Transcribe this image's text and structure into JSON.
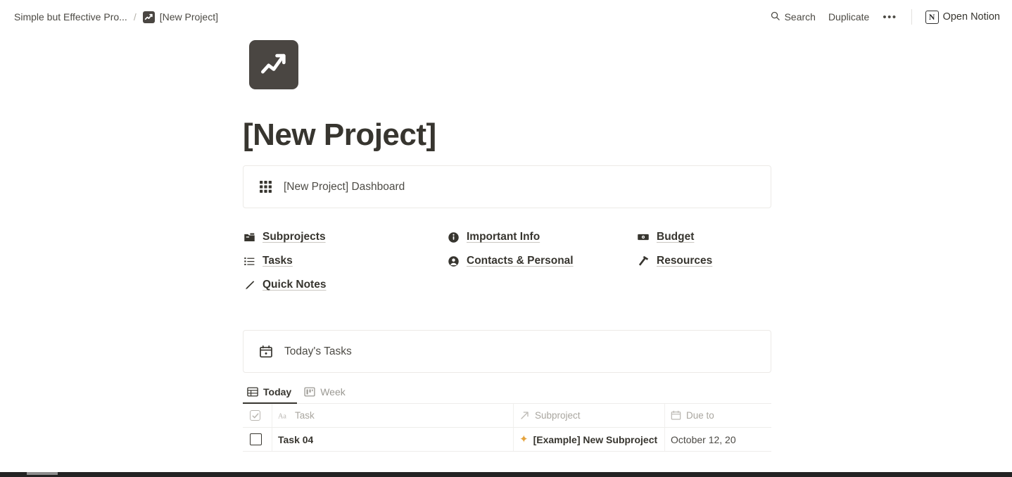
{
  "topbar": {
    "breadcrumb": {
      "parent_label": "Simple but Effective Pro...",
      "separator": "/",
      "current_label": "[New Project]",
      "current_icon": "chart-line-icon"
    },
    "search_label": "Search",
    "search_icon": "search-icon",
    "duplicate_label": "Duplicate",
    "more_label": "•••",
    "more_icon": "ellipsis-icon",
    "notion_logo_letter": "N",
    "open_notion_label": "Open Notion"
  },
  "page": {
    "icon": "chart-line-icon",
    "title": "[New Project]"
  },
  "dashboard_callout": {
    "icon": "grid-icon",
    "text": "[New Project] Dashboard"
  },
  "links": {
    "columns": [
      {
        "items": [
          {
            "icon": "folder-icon",
            "label": "Subprojects"
          },
          {
            "icon": "list-icon",
            "label": "Tasks"
          },
          {
            "icon": "pencil-icon",
            "label": "Quick Notes"
          }
        ]
      },
      {
        "items": [
          {
            "icon": "info-circle-icon",
            "label": "Important Info"
          },
          {
            "icon": "person-circle-icon",
            "label": "Contacts & Personal"
          }
        ]
      },
      {
        "items": [
          {
            "icon": "banknote-icon",
            "label": "Budget"
          },
          {
            "icon": "hammer-icon",
            "label": "Resources"
          }
        ]
      }
    ]
  },
  "today_callout": {
    "icon": "calendar-icon",
    "text": "Today's Tasks"
  },
  "tabs": [
    {
      "icon": "table-icon",
      "label": "Today",
      "active": true
    },
    {
      "icon": "board-icon",
      "label": "Week",
      "active": false
    }
  ],
  "table": {
    "headers": [
      {
        "icon": "checkbox-checked-icon",
        "label": ""
      },
      {
        "icon": "text-type-icon",
        "label": "Task"
      },
      {
        "icon": "relation-arrow-icon",
        "label": "Subproject"
      },
      {
        "icon": "calendar-icon",
        "label": "Due to"
      }
    ],
    "rows": [
      {
        "checked": false,
        "task": "Task 04",
        "subproject_icon": "star-icon",
        "subproject": "[Example] New Subproject",
        "due": "October 12, 20"
      }
    ]
  },
  "colors": {
    "icon_bg": "#4a4642",
    "text": "#37352f",
    "muted": "#a9a69f",
    "star": "#e5a33c",
    "bottom_bar": "#232323"
  }
}
